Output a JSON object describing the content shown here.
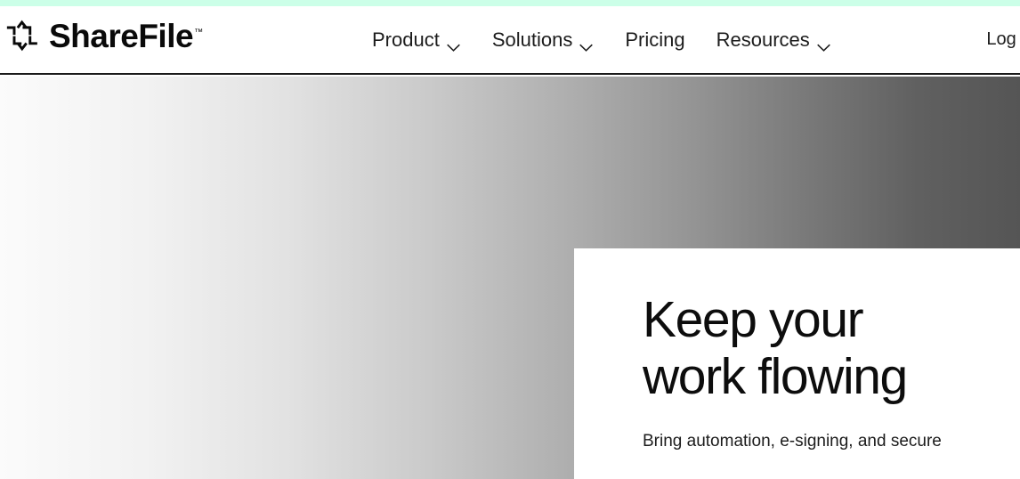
{
  "accent": {
    "color": "#ccffe8"
  },
  "header": {
    "brand": {
      "name": "ShareFile",
      "trademark": "™",
      "logo_icon": "sharefile-pinwheel-icon"
    },
    "nav": [
      {
        "label": "Product",
        "has_dropdown": true,
        "icon": "chevron-down-icon"
      },
      {
        "label": "Solutions",
        "has_dropdown": true,
        "icon": "chevron-down-icon"
      },
      {
        "label": "Pricing",
        "has_dropdown": false,
        "icon": ""
      },
      {
        "label": "Resources",
        "has_dropdown": true,
        "icon": "chevron-down-icon"
      }
    ],
    "auth": {
      "login_label": "Log In"
    },
    "border_color": "#1a1a1a",
    "background": "#ffffff"
  },
  "hero": {
    "background_gradient_from": "#fbfbfb",
    "background_gradient_to": "#555555",
    "card": {
      "background": "#ffffff",
      "title_line1": "Keep your",
      "title_line2": "work flowing",
      "subtitle": "Bring automation, e-signing, and secure"
    }
  }
}
